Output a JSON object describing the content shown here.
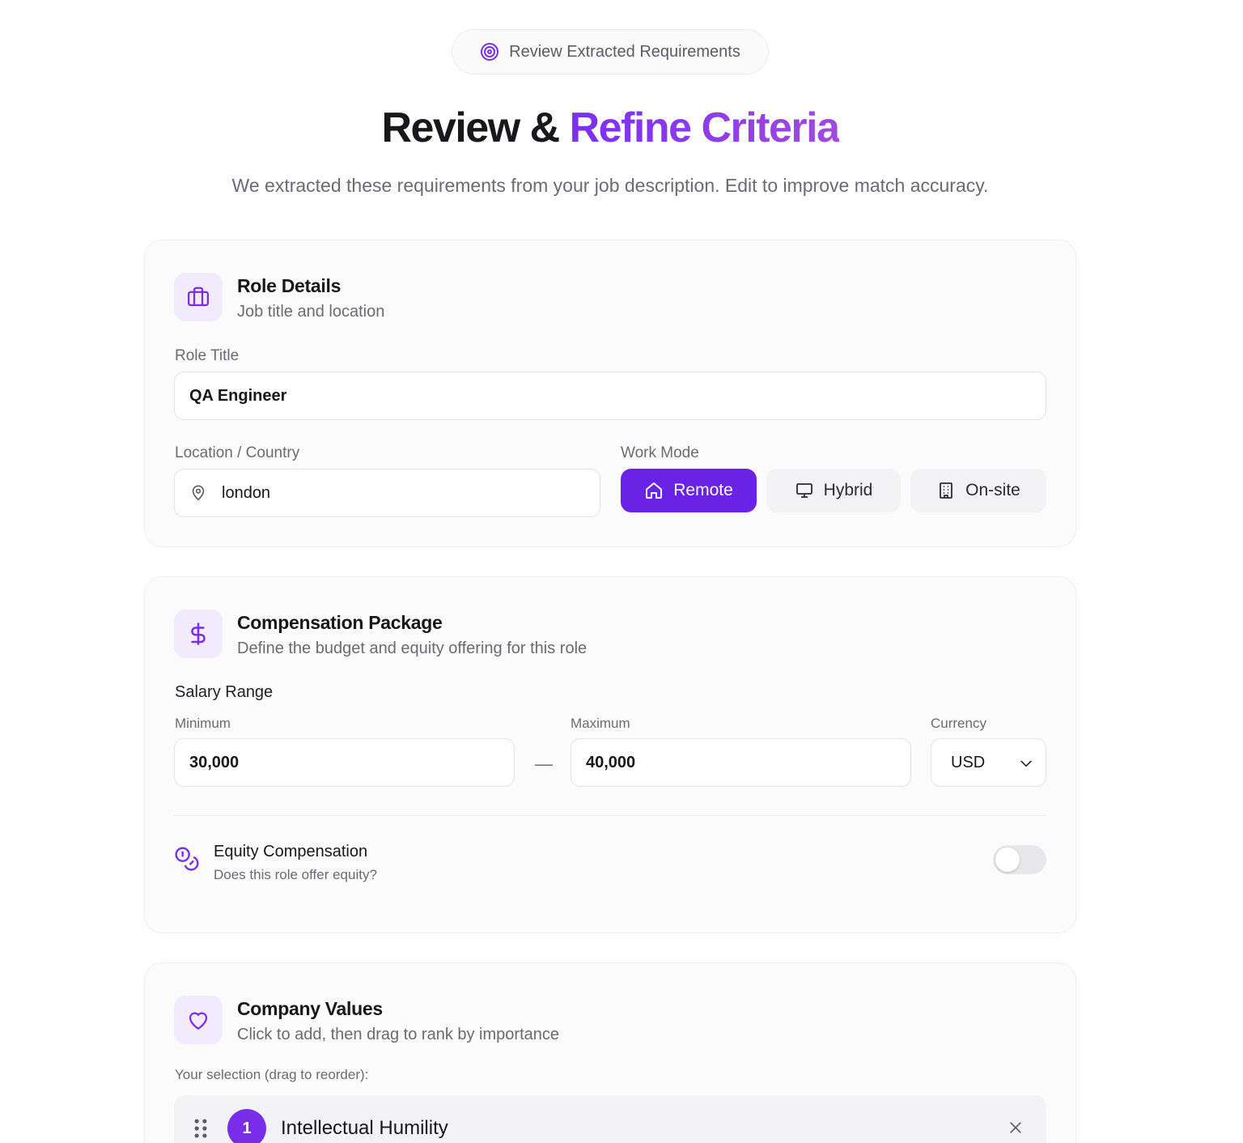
{
  "badge": {
    "label": "Review Extracted Requirements",
    "icon": "target-icon"
  },
  "hero": {
    "title_part1": "Review & ",
    "title_part2": "Refine Criteria",
    "subtitle": "We extracted these requirements from your job description. Edit to improve match accuracy."
  },
  "role": {
    "title": "Role Details",
    "subtitle": "Job title and location",
    "role_title_label": "Role Title",
    "role_title_value": "QA Engineer",
    "location_label": "Location / Country",
    "location_value": "london",
    "work_mode_label": "Work Mode",
    "work_modes": [
      {
        "label": "Remote",
        "icon": "home-icon",
        "selected": true
      },
      {
        "label": "Hybrid",
        "icon": "monitor-icon",
        "selected": false
      },
      {
        "label": "On-site",
        "icon": "building-icon",
        "selected": false
      }
    ]
  },
  "compensation": {
    "title": "Compensation Package",
    "subtitle": "Define the budget and equity offering for this role",
    "salary_label": "Salary Range",
    "min_label": "Minimum",
    "min_value": "30,000",
    "range_separator": "—",
    "max_label": "Maximum",
    "max_value": "40,000",
    "currency_label": "Currency",
    "currency_value": "USD",
    "equity_title": "Equity Compensation",
    "equity_subtitle": "Does this role offer equity?",
    "equity_enabled": false
  },
  "values": {
    "title": "Company Values",
    "subtitle": "Click to add, then drag to rank by importance",
    "selection_label": "Your selection (drag to reorder):",
    "selected": [
      {
        "rank": "1",
        "label": "Intellectual Humility"
      }
    ]
  },
  "colors": {
    "accent": "#6a22e4",
    "accent_light": "#f1ebfd"
  }
}
